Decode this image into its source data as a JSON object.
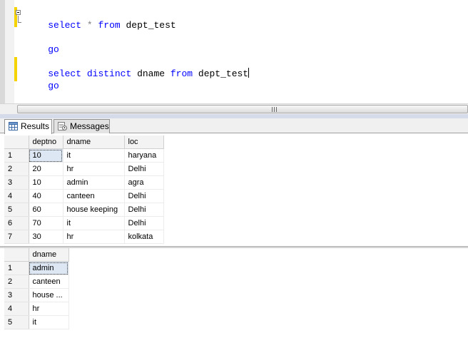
{
  "editor": {
    "lines": [
      {
        "parts": [
          {
            "t": "select",
            "c": "kw"
          },
          {
            "t": " ",
            "c": "id"
          },
          {
            "t": "*",
            "c": "op"
          },
          {
            "t": " ",
            "c": "id"
          },
          {
            "t": "from",
            "c": "kw"
          },
          {
            "t": " dept_test",
            "c": "id"
          }
        ]
      },
      {
        "parts": [
          {
            "t": "go",
            "c": "kw"
          }
        ]
      },
      {
        "parts": [
          {
            "t": "select",
            "c": "kw"
          },
          {
            "t": " ",
            "c": "id"
          },
          {
            "t": "distinct",
            "c": "kw"
          },
          {
            "t": " dname ",
            "c": "id"
          },
          {
            "t": "from",
            "c": "kw"
          },
          {
            "t": " dept_test",
            "c": "id"
          }
        ]
      },
      {
        "parts": [
          {
            "t": "go",
            "c": "kw"
          }
        ]
      }
    ],
    "change_bar_color": "#f5d300"
  },
  "scrollbar": {
    "grip_icon": "grip-lines-icon"
  },
  "tabs": [
    {
      "label": "Results",
      "icon": "grid-icon",
      "active": true
    },
    {
      "label": "Messages",
      "icon": "messages-icon",
      "active": false
    }
  ],
  "grid1": {
    "columns": [
      "deptno",
      "dname",
      "loc"
    ],
    "rows": [
      [
        "1",
        "10",
        "it",
        "haryana"
      ],
      [
        "2",
        "20",
        "hr",
        "Delhi"
      ],
      [
        "3",
        "10",
        "admin",
        "agra"
      ],
      [
        "4",
        "40",
        "canteen",
        "Delhi"
      ],
      [
        "5",
        "60",
        "house keeping",
        "Delhi"
      ],
      [
        "6",
        "70",
        "it",
        "Delhi"
      ],
      [
        "7",
        "30",
        "hr",
        "kolkata"
      ]
    ]
  },
  "grid2": {
    "columns": [
      "dname"
    ],
    "rows": [
      [
        "1",
        "admin"
      ],
      [
        "2",
        "canteen"
      ],
      [
        "3",
        "house ..."
      ],
      [
        "4",
        "hr"
      ],
      [
        "5",
        "it"
      ]
    ]
  }
}
